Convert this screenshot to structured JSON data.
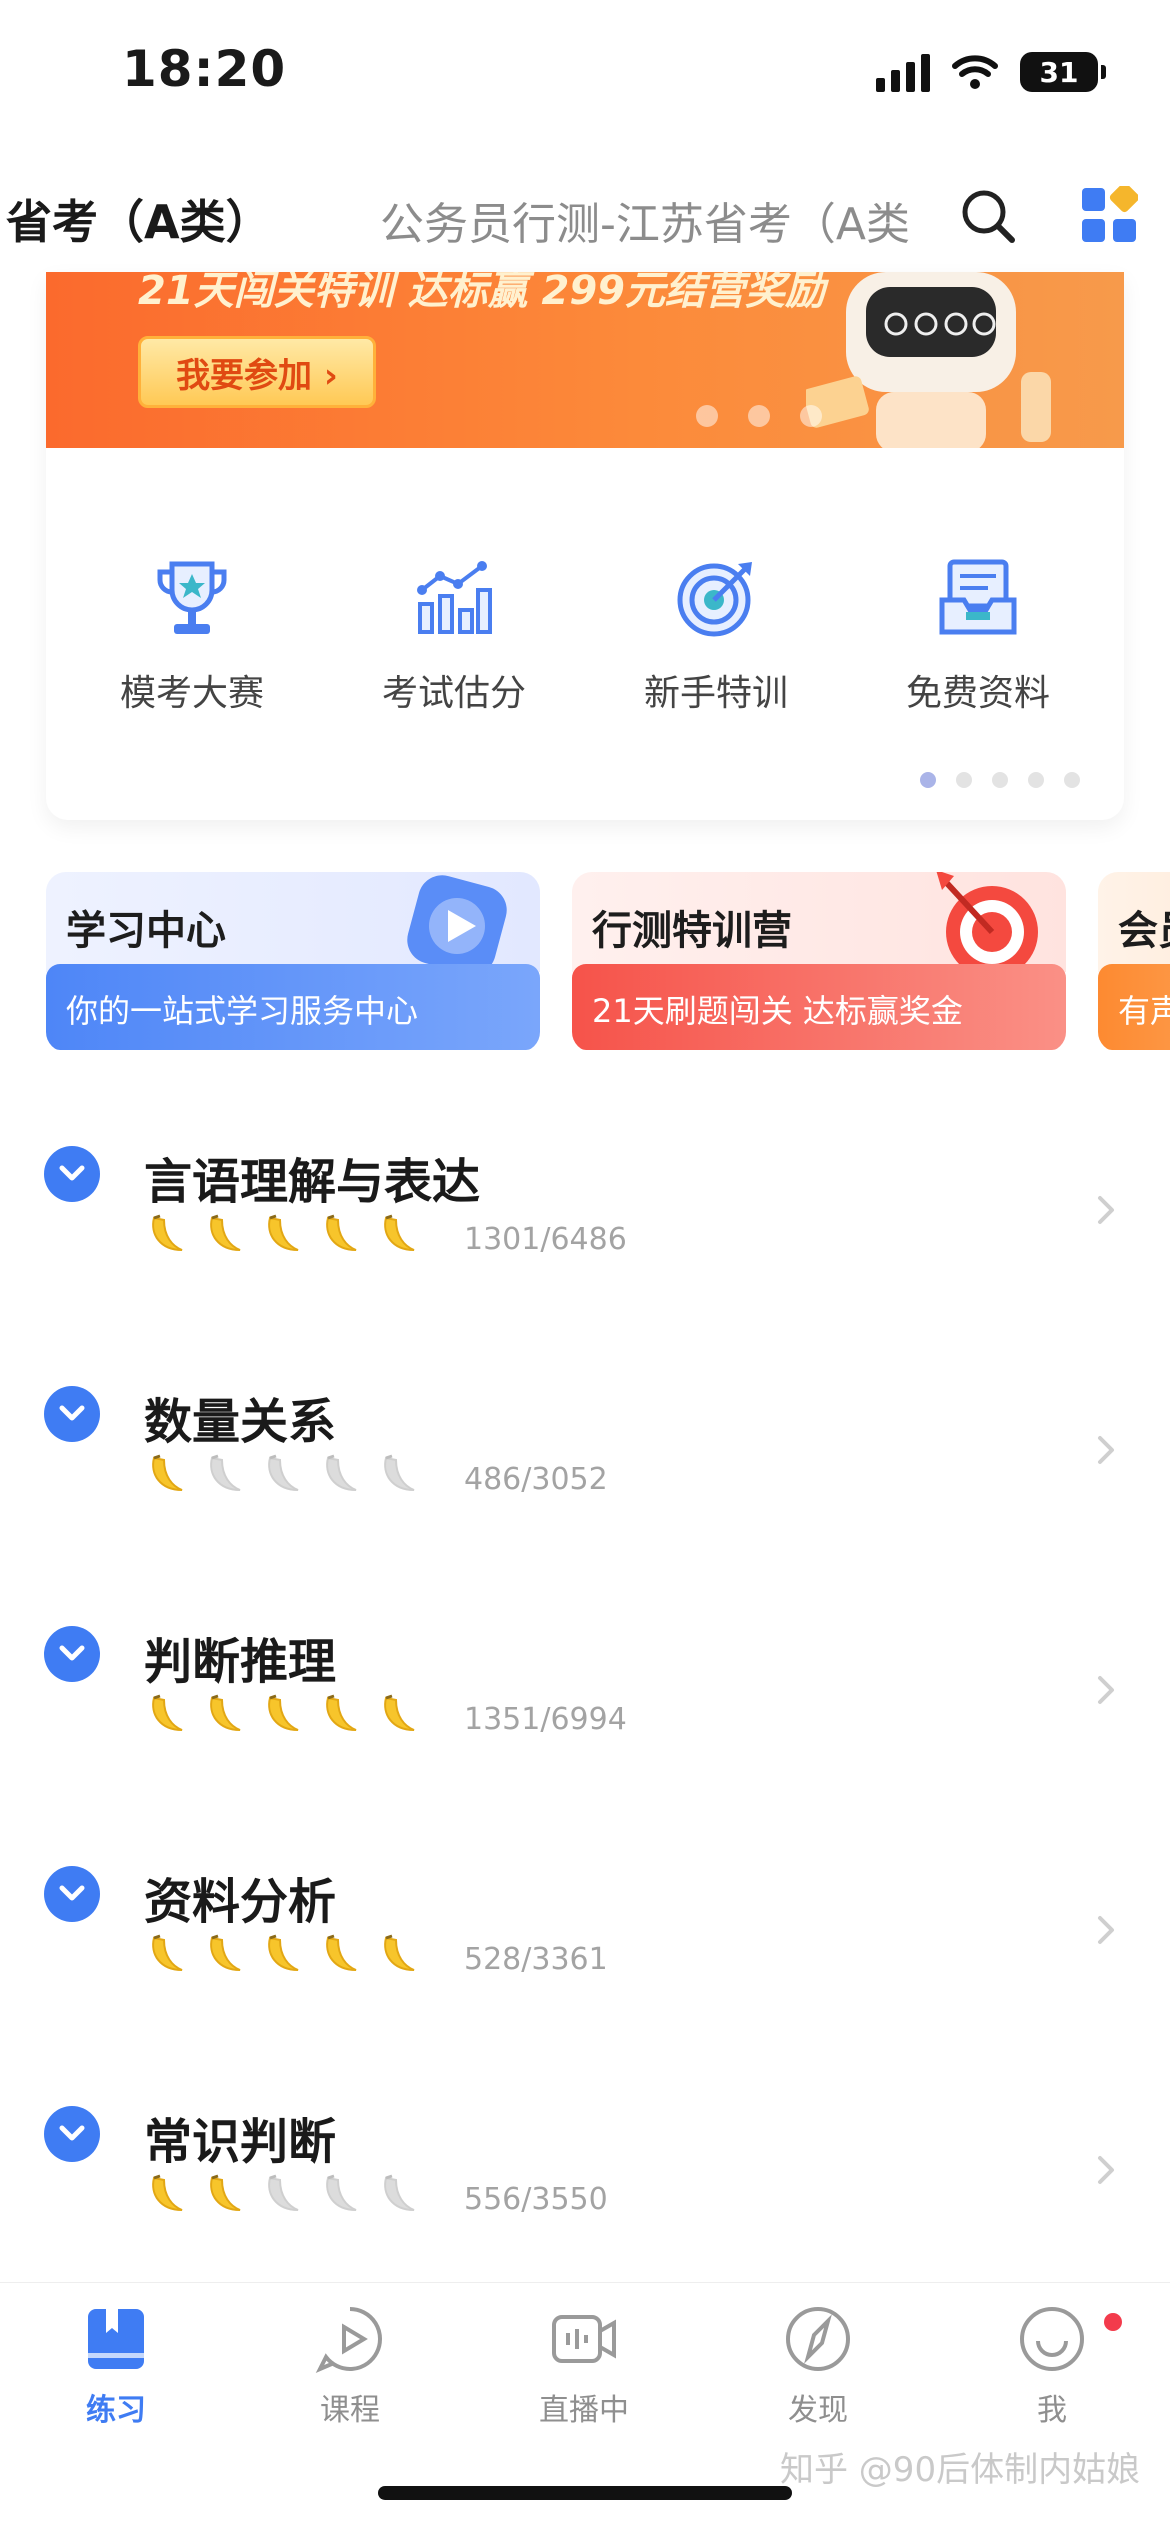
{
  "status_bar": {
    "time": "18:20",
    "battery": "31"
  },
  "header": {
    "title": "省考（A类）",
    "subtitle": "公务员行测-江苏省考（A类",
    "search_icon": "search-icon",
    "apps_icon": "apps-grid-icon"
  },
  "banner": {
    "headline": "21天闯关特训 达标赢 299元结营奖励",
    "button_label": "我要参加 ›",
    "colors": {
      "start": "#fb6a2d",
      "end": "#f79a4b"
    }
  },
  "quick_entries": [
    {
      "label": "模考大赛",
      "icon": "trophy-icon"
    },
    {
      "label": "考试估分",
      "icon": "bar-chart-icon"
    },
    {
      "label": "新手特训",
      "icon": "target-icon"
    },
    {
      "label": "免费资料",
      "icon": "document-tray-icon"
    }
  ],
  "features": [
    {
      "title": "学习中心",
      "subtitle": "你的一站式学习服务中心",
      "icon": "play-icon"
    },
    {
      "title": "行测特训营",
      "subtitle": "21天刷题闯关 达标赢奖金",
      "icon": "dart-target-icon"
    },
    {
      "title": "会员",
      "subtitle": "有声"
    }
  ],
  "subjects": [
    {
      "name": "言语理解与表达",
      "progress": "1301/6486",
      "level": 5
    },
    {
      "name": "数量关系",
      "progress": "486/3052",
      "level": 1
    },
    {
      "name": "判断推理",
      "progress": "1351/6994",
      "level": 5
    },
    {
      "name": "资料分析",
      "progress": "528/3361",
      "level": 5
    },
    {
      "name": "常识判断",
      "progress": "556/3550",
      "level": 2
    }
  ],
  "tabs": [
    {
      "label": "练习",
      "icon": "book-icon",
      "active": true
    },
    {
      "label": "课程",
      "icon": "play-bubble-icon"
    },
    {
      "label": "直播中",
      "icon": "live-camera-icon"
    },
    {
      "label": "发现",
      "icon": "compass-icon"
    },
    {
      "label": "我",
      "icon": "smile-icon"
    }
  ],
  "watermark": "知乎 @90后体制内姑娘",
  "accent_color": "#3f7cf3"
}
